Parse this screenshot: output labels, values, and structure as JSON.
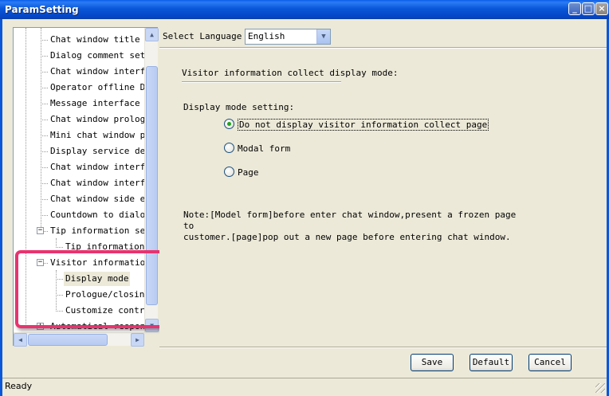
{
  "window": {
    "title": "ParamSetting",
    "controls": {
      "minimize": "_",
      "maximize": "□",
      "close": "×"
    }
  },
  "tree": {
    "items": [
      {
        "label": "Chat window title se",
        "level": 2
      },
      {
        "label": "Dialog comment setti",
        "level": 2
      },
      {
        "label": "Chat window interfac",
        "level": 2
      },
      {
        "label": "Operator offline Dis",
        "level": 2
      },
      {
        "label": "Message interface se",
        "level": 2
      },
      {
        "label": "Chat window prologue",
        "level": 2
      },
      {
        "label": "Mini chat window pro",
        "level": 2
      },
      {
        "label": "Display service deps",
        "level": 2
      },
      {
        "label": "Chat window interfac",
        "level": 2
      },
      {
        "label": "Chat window interfac",
        "level": 2
      },
      {
        "label": "Chat window side edg",
        "level": 2
      },
      {
        "label": "Countdown to dialog",
        "level": 2
      },
      {
        "label": "Tip information sett",
        "level": 1,
        "expander": "−"
      },
      {
        "label": "Tip information b",
        "level": 3
      },
      {
        "label": "Visitor information",
        "level": 1,
        "expander": "−"
      },
      {
        "label": "Display mode",
        "level": 3,
        "selected": true
      },
      {
        "label": "Prologue/closing",
        "level": 3
      },
      {
        "label": "Customize control",
        "level": 3
      },
      {
        "label": "Automatical response",
        "level": 1,
        "expander": "+"
      }
    ]
  },
  "language": {
    "label": "Select Language",
    "selected": "English"
  },
  "panel": {
    "title": "Visitor information collect display mode:",
    "mode_label": "Display mode setting:",
    "options": [
      {
        "label": "Do not display visitor information collect page",
        "checked": true
      },
      {
        "label": "Modal form",
        "checked": false
      },
      {
        "label": "Page",
        "checked": false
      }
    ],
    "note": "Note:[Model form]before enter chat window,present a frozen page to\ncustomer.[page]pop out a new page before entering chat window."
  },
  "buttons": {
    "save": "Save",
    "default": "Default",
    "cancel": "Cancel"
  },
  "status": {
    "text": "Ready"
  }
}
